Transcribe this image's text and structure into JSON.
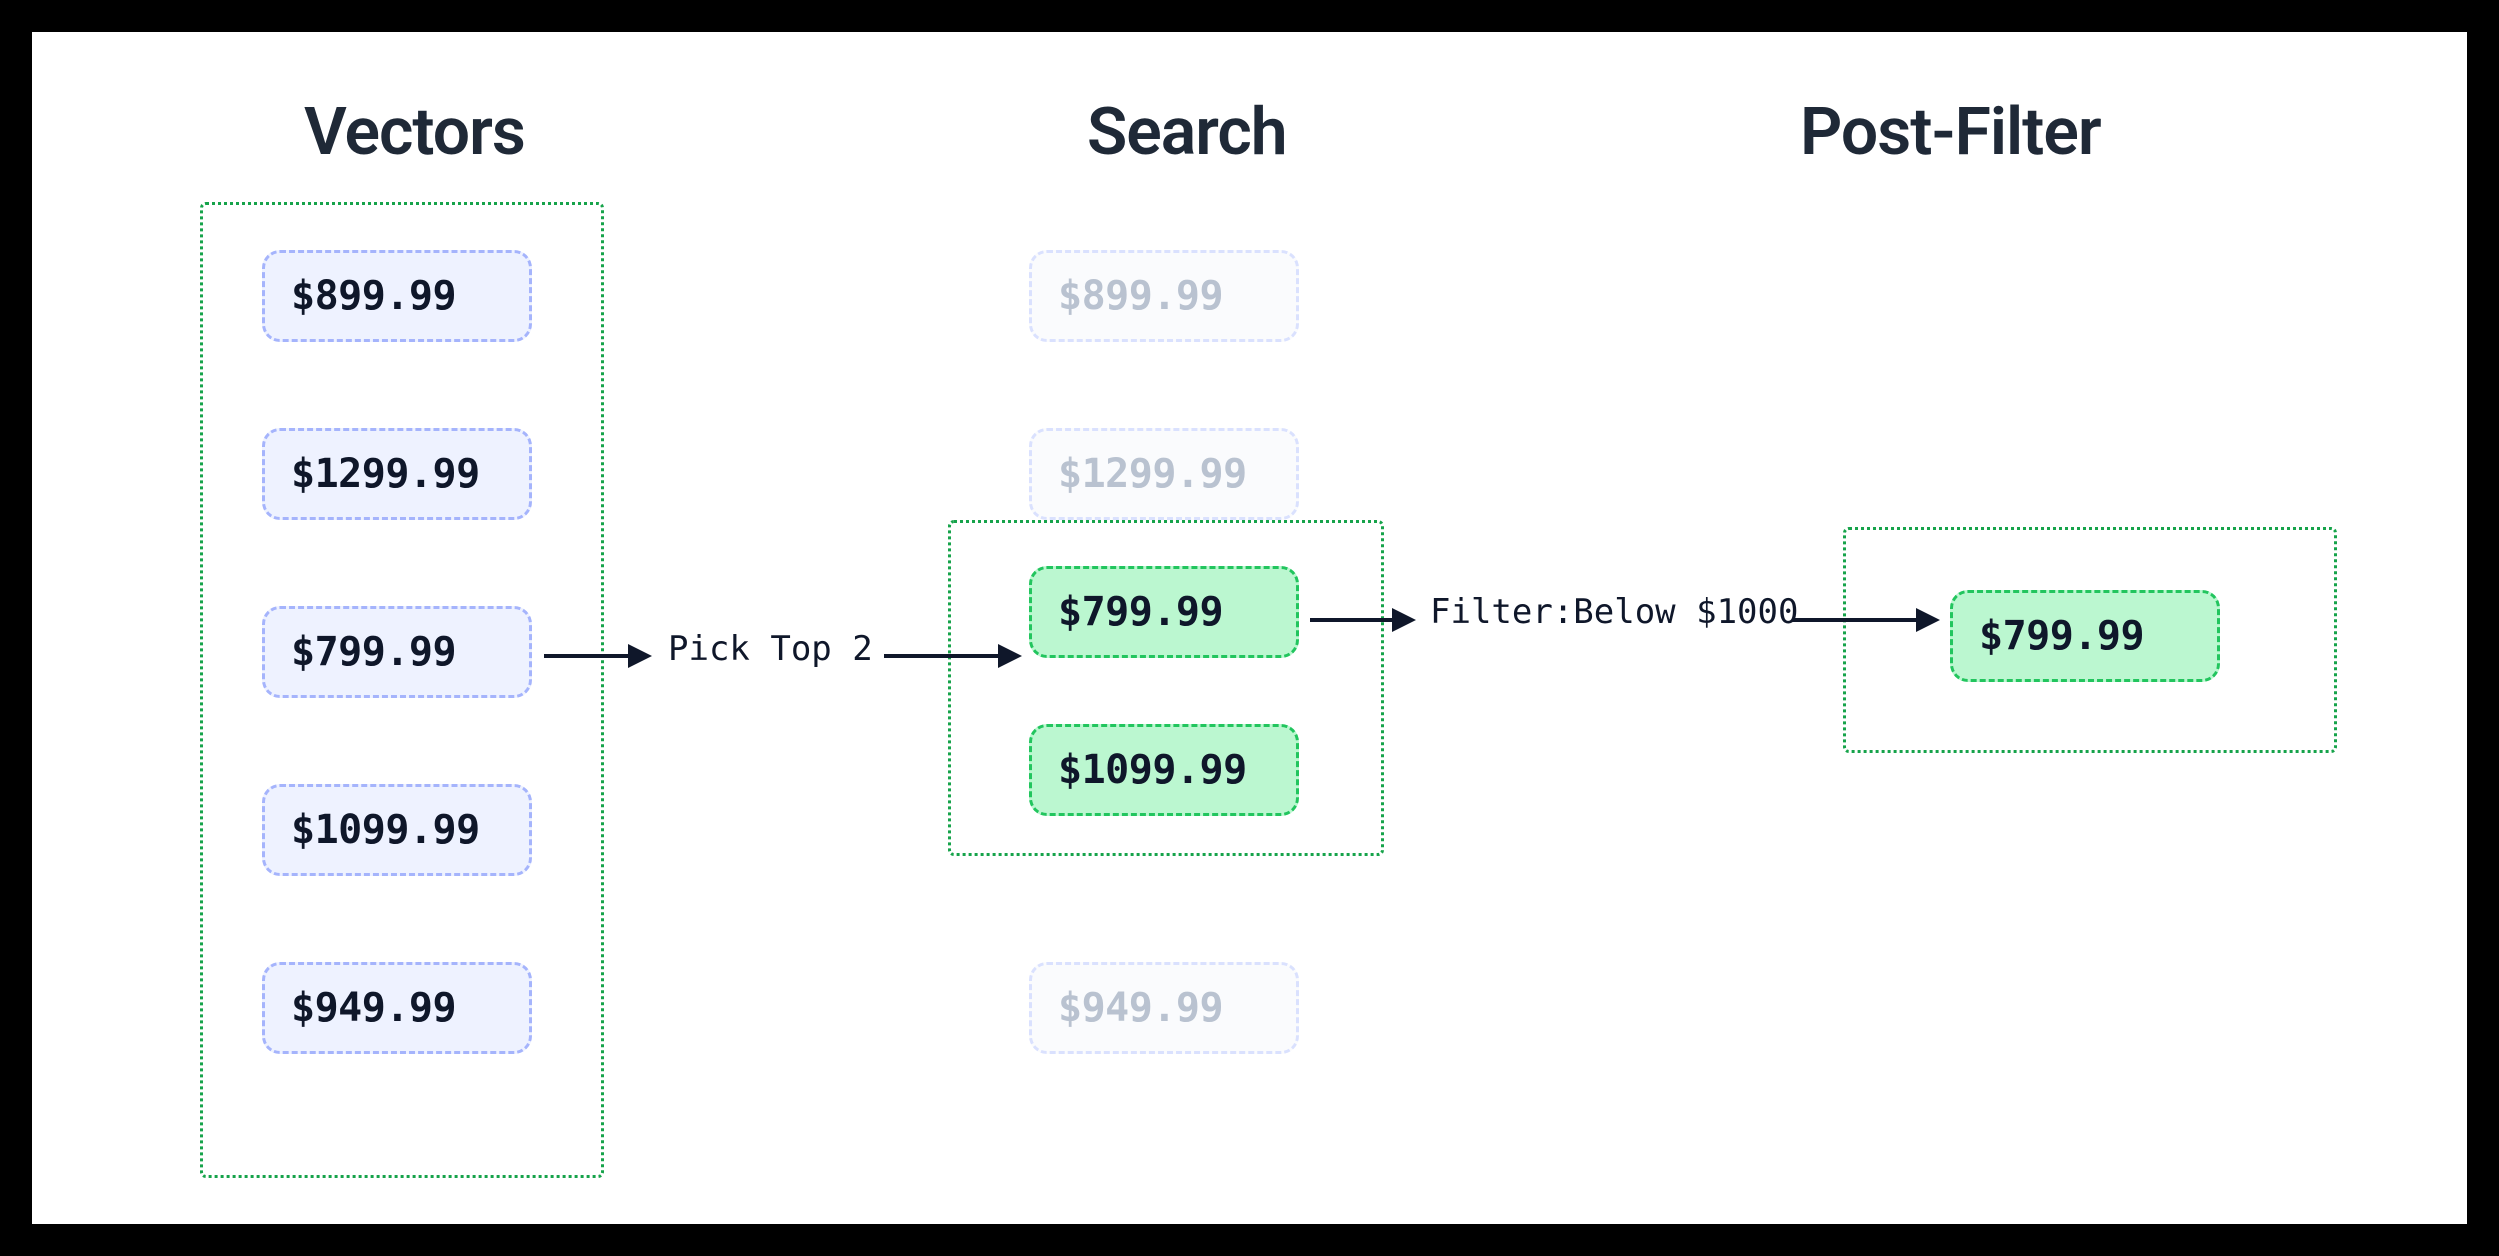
{
  "titles": {
    "vectors": "Vectors",
    "search": "Search",
    "postfilter": "Post-Filter"
  },
  "vectors": {
    "items": [
      "$899.99",
      "$1299.99",
      "$799.99",
      "$1099.99",
      "$949.99"
    ]
  },
  "search": {
    "items": [
      {
        "value": "$899.99",
        "state": "faded"
      },
      {
        "value": "$1299.99",
        "state": "faded"
      },
      {
        "value": "$799.99",
        "state": "selected"
      },
      {
        "value": "$1099.99",
        "state": "selected"
      },
      {
        "value": "$949.99",
        "state": "faded"
      }
    ]
  },
  "postfilter": {
    "items": [
      "$799.99"
    ]
  },
  "arrows": {
    "pick_top": "Pick Top 2",
    "filter": "Filter:Below $1000"
  }
}
